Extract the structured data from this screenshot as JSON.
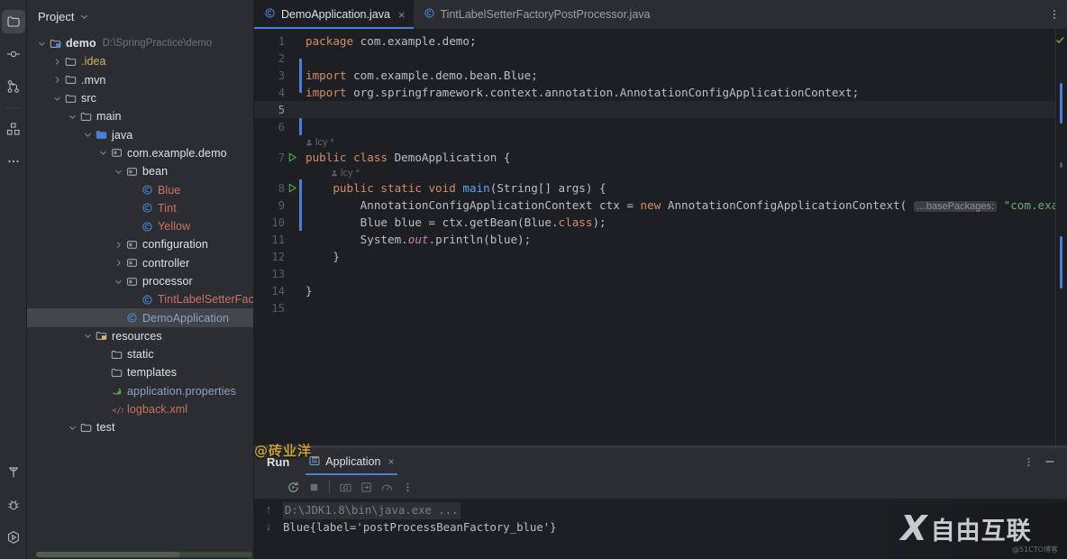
{
  "rail": {
    "top_items": [
      {
        "name": "project-tool-button",
        "icon": "folder-icon",
        "active": true
      },
      {
        "name": "commit-tool-button",
        "icon": "commit-icon",
        "active": false
      },
      {
        "name": "pull-requests-tool-button",
        "icon": "branch-icon",
        "active": false
      },
      {
        "name": "structure-tool-button",
        "icon": "structure-icon",
        "active": false
      },
      {
        "name": "more-tool-button",
        "icon": "more-horizontal-icon",
        "active": false
      }
    ],
    "bottom_items": [
      {
        "name": "build-tool-button",
        "icon": "hammer-icon"
      },
      {
        "name": "debug-tool-button",
        "icon": "bug-icon"
      },
      {
        "name": "run-tool-button",
        "icon": "run-icon"
      }
    ]
  },
  "project": {
    "header_title": "Project",
    "tree": [
      {
        "label": "demo",
        "sub": "D:\\SpringPractice\\demo",
        "indent": 0,
        "arrow": "down",
        "icon": "module-icon",
        "color": "white",
        "bold": true,
        "selected": false
      },
      {
        "label": ".idea",
        "sub": "",
        "indent": 1,
        "arrow": "right",
        "icon": "folder-icon",
        "color": "yellow",
        "bold": false,
        "selected": false
      },
      {
        "label": ".mvn",
        "sub": "",
        "indent": 1,
        "arrow": "right",
        "icon": "folder-icon",
        "color": "white",
        "bold": false,
        "selected": false
      },
      {
        "label": "src",
        "sub": "",
        "indent": 1,
        "arrow": "down",
        "icon": "folder-icon",
        "color": "white",
        "bold": false,
        "selected": false
      },
      {
        "label": "main",
        "sub": "",
        "indent": 2,
        "arrow": "down",
        "icon": "folder-icon",
        "color": "white",
        "bold": false,
        "selected": false
      },
      {
        "label": "java",
        "sub": "",
        "indent": 3,
        "arrow": "down",
        "icon": "source-folder-icon",
        "color": "white",
        "bold": false,
        "selected": false
      },
      {
        "label": "com.example.demo",
        "sub": "",
        "indent": 4,
        "arrow": "down",
        "icon": "package-icon",
        "color": "white",
        "bold": false,
        "selected": false
      },
      {
        "label": "bean",
        "sub": "",
        "indent": 5,
        "arrow": "down",
        "icon": "package-icon",
        "color": "white",
        "bold": false,
        "selected": false
      },
      {
        "label": "Blue",
        "sub": "",
        "indent": 6,
        "arrow": "none",
        "icon": "class-icon",
        "color": "red",
        "bold": false,
        "selected": false
      },
      {
        "label": "Tint",
        "sub": "",
        "indent": 6,
        "arrow": "none",
        "icon": "class-icon",
        "color": "red",
        "bold": false,
        "selected": false
      },
      {
        "label": "Yellow",
        "sub": "",
        "indent": 6,
        "arrow": "none",
        "icon": "class-icon",
        "color": "red",
        "bold": false,
        "selected": false
      },
      {
        "label": "configuration",
        "sub": "",
        "indent": 5,
        "arrow": "right",
        "icon": "package-icon",
        "color": "white",
        "bold": false,
        "selected": false
      },
      {
        "label": "controller",
        "sub": "",
        "indent": 5,
        "arrow": "right",
        "icon": "package-icon",
        "color": "white",
        "bold": false,
        "selected": false
      },
      {
        "label": "processor",
        "sub": "",
        "indent": 5,
        "arrow": "down",
        "icon": "package-icon",
        "color": "white",
        "bold": false,
        "selected": false
      },
      {
        "label": "TintLabelSetterFactoryPostProcessor",
        "sub": "",
        "indent": 6,
        "arrow": "none",
        "icon": "class-icon",
        "color": "red",
        "bold": false,
        "selected": false
      },
      {
        "label": "DemoApplication",
        "sub": "",
        "indent": 5,
        "arrow": "none",
        "icon": "class-icon",
        "color": "blue",
        "bold": false,
        "selected": true
      },
      {
        "label": "resources",
        "sub": "",
        "indent": 3,
        "arrow": "down",
        "icon": "resource-folder-icon",
        "color": "white",
        "bold": false,
        "selected": false
      },
      {
        "label": "static",
        "sub": "",
        "indent": 4,
        "arrow": "none",
        "icon": "folder-icon",
        "color": "white",
        "bold": false,
        "selected": false
      },
      {
        "label": "templates",
        "sub": "",
        "indent": 4,
        "arrow": "none",
        "icon": "folder-icon",
        "color": "white",
        "bold": false,
        "selected": false
      },
      {
        "label": "application.properties",
        "sub": "",
        "indent": 4,
        "arrow": "none",
        "icon": "spring-properties-icon",
        "color": "blue",
        "bold": false,
        "selected": false
      },
      {
        "label": "logback.xml",
        "sub": "",
        "indent": 4,
        "arrow": "none",
        "icon": "xml-icon",
        "color": "red",
        "bold": false,
        "selected": false
      },
      {
        "label": "test",
        "sub": "",
        "indent": 2,
        "arrow": "down",
        "icon": "folder-icon",
        "color": "white",
        "bold": false,
        "selected": false
      }
    ]
  },
  "editor": {
    "tabs": [
      {
        "label": "DemoApplication.java",
        "active": true,
        "closable": true
      },
      {
        "label": "TintLabelSetterFactoryPostProcessor.java",
        "active": false,
        "closable": false
      }
    ],
    "code_vision_author": "lcy *",
    "inlay_hint": "…basePackages:",
    "lines": [
      {
        "num": "1",
        "current": false,
        "changed": false,
        "run": false
      },
      {
        "num": "2",
        "current": false,
        "changed": false,
        "run": false
      },
      {
        "num": "3",
        "current": false,
        "changed": true,
        "run": false
      },
      {
        "num": "4",
        "current": false,
        "changed": true,
        "run": false
      },
      {
        "num": "5",
        "current": true,
        "changed": false,
        "run": false
      },
      {
        "num": "6",
        "current": false,
        "changed": true,
        "run": false
      },
      {
        "num": "7",
        "current": false,
        "changed": false,
        "run": true
      },
      {
        "num": "8",
        "current": false,
        "changed": false,
        "run": true
      },
      {
        "num": "9",
        "current": false,
        "changed": true,
        "run": false
      },
      {
        "num": "10",
        "current": false,
        "changed": true,
        "run": false
      },
      {
        "num": "11",
        "current": false,
        "changed": true,
        "run": false
      },
      {
        "num": "12",
        "current": false,
        "changed": false,
        "run": false
      },
      {
        "num": "13",
        "current": false,
        "changed": false,
        "run": false
      },
      {
        "num": "14",
        "current": false,
        "changed": false,
        "run": false
      },
      {
        "num": "15",
        "current": false,
        "changed": false,
        "run": false
      }
    ],
    "code_text": {
      "l1_kw": "package",
      "l1_rest": " com.example.demo;",
      "l3_kw": "import",
      "l3_rest": " com.example.demo.bean.Blue;",
      "l4_kw": "import",
      "l4_rest": " org.springframework.context.annotation.AnnotationConfigApplicationContext;",
      "l7_a": "public class",
      "l7_b": " DemoApplication {",
      "l8_a": "    public static void ",
      "l8_b": "main",
      "l8_c": "(String[] args) {",
      "l9_a": "        AnnotationConfigApplicationContext ctx = ",
      "l9_kw": "new",
      "l9_b": " AnnotationConfigApplicationContext( ",
      "l9_str": "\"com.example.demo\"",
      "l9_c": ");",
      "l10": "        Blue blue = ctx.getBean(Blue.",
      "l10_kw": "class",
      "l10_b": ");",
      "l11_a": "        System.",
      "l11_field": "out",
      "l11_b": ".println(blue);",
      "l12": "    }",
      "l14": "}"
    }
  },
  "run_panel": {
    "title": "Run",
    "tab_label": "Application",
    "tab_close": "×",
    "toolbar": [
      {
        "name": "rerun-button",
        "icon": "rerun-icon"
      },
      {
        "name": "stop-button",
        "icon": "stop-icon"
      },
      {
        "name": "screenshot-button",
        "icon": "camera-icon"
      },
      {
        "name": "export-button",
        "icon": "export-icon"
      },
      {
        "name": "profiler-button",
        "icon": "gauge-icon"
      },
      {
        "name": "more-options-button",
        "icon": "more-vertical-icon"
      }
    ],
    "header_actions": [
      {
        "name": "run-panel-options-button",
        "icon": "more-vertical-icon"
      },
      {
        "name": "run-panel-minimize-button",
        "icon": "minimize-icon"
      }
    ],
    "console": {
      "command_line": "D:\\JDK1.8\\bin\\java.exe ...",
      "output_line": "Blue{label='postProcessBeanFactory_blue'}"
    },
    "nav": {
      "up": "↑",
      "down": "↓"
    }
  },
  "overlays": {
    "watermark": "@砖业洋_",
    "brand_x": "X",
    "brand_text": "自由互联",
    "brand_sub": "@51CTO博客"
  },
  "colors": {
    "accent": "#4b7fd6",
    "editor_bg": "#1e1f22",
    "panel_bg": "#2b2d30",
    "keyword": "#cf8e6d",
    "string": "#6aab73",
    "method": "#56a8f5",
    "static_field": "#c77dbb",
    "class_red": "#c9736b",
    "folder_yellow": "#cdb760",
    "watermark_gold": "#c8a13a"
  }
}
